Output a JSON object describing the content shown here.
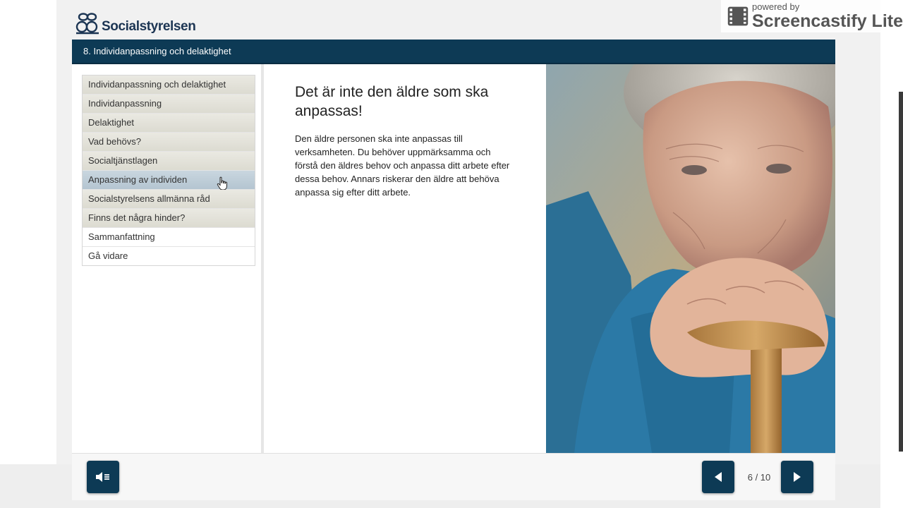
{
  "brand": {
    "name": "Socialstyrelsen"
  },
  "watermark": {
    "small": "powered by",
    "big": "Screencastify Lite"
  },
  "module": {
    "title": "8. Individanpassning och delaktighet"
  },
  "menu": {
    "items": [
      {
        "label": "Individanpassning och delaktighet",
        "state": "visited"
      },
      {
        "label": "Individanpassning",
        "state": "visited"
      },
      {
        "label": "Delaktighet",
        "state": "visited"
      },
      {
        "label": "Vad behövs?",
        "state": "visited"
      },
      {
        "label": "Socialtjänstlagen",
        "state": "visited"
      },
      {
        "label": "Anpassning av individen",
        "state": "active"
      },
      {
        "label": "Socialstyrelsens allmänna råd",
        "state": "visited"
      },
      {
        "label": "Finns det några hinder?",
        "state": "visited"
      },
      {
        "label": "Sammanfattning",
        "state": "unvisited"
      },
      {
        "label": "Gå vidare",
        "state": "unvisited"
      }
    ]
  },
  "content": {
    "heading": "Det är inte den äldre som ska anpassas!",
    "body": "Den äldre personen ska inte anpassas till verksamheten. Du behöver uppmärksamma och förstå den äldres behov och anpassa ditt arbete efter dessa behov. Annars riskerar den äldre att behöva anpassa sig efter ditt arbete."
  },
  "navigation": {
    "page_counter": "6 / 10",
    "current_page": 6,
    "total_pages": 10
  },
  "icons": {
    "audio": "speaker-icon",
    "prev": "triangle-left-icon",
    "next": "triangle-right-icon",
    "cursor": "hand-pointer-icon"
  },
  "colors": {
    "primary": "#0d3a55",
    "active_menu": "#b4c5d1",
    "visited_menu": "#dcdbd1"
  }
}
